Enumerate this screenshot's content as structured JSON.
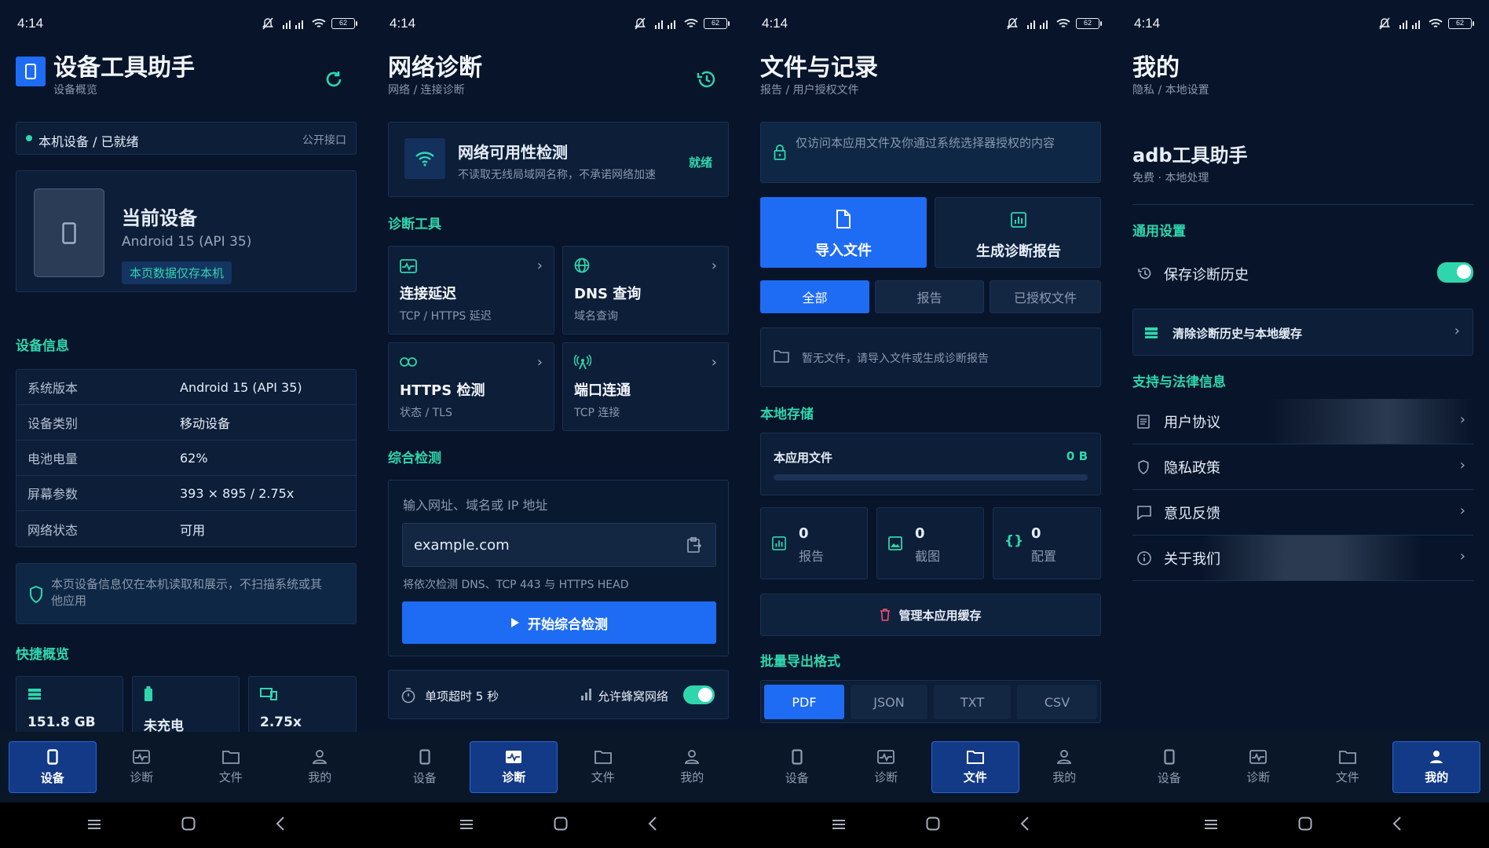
{
  "status_bar": {
    "time": "4:14",
    "battery": "62"
  },
  "nav": {
    "device": "设备",
    "diagnose": "诊断",
    "files": "文件",
    "mine": "我的"
  },
  "screen1": {
    "title": "设备工具助手",
    "subtitle": "设备概览",
    "status_label": "本机设备 / 已就绪",
    "status_right": "公开接口",
    "device_card": {
      "title": "当前设备",
      "os": "Android 15 (API 35)",
      "badge": "本页数据仅存本机"
    },
    "info_section": "设备信息",
    "info_rows": [
      {
        "key": "系统版本",
        "value": "Android 15 (API 35)"
      },
      {
        "key": "设备类别",
        "value": "移动设备"
      },
      {
        "key": "电池电量",
        "value": "62%"
      },
      {
        "key": "屏幕参数",
        "value": "393 × 895 / 2.75x"
      },
      {
        "key": "网络状态",
        "value": "可用"
      }
    ],
    "notice": "本页设备信息仅在本机读取和展示，不扫描系统或其他应用",
    "quick_section": "快捷概览",
    "quick": [
      {
        "value": "151.8 GB"
      },
      {
        "value": "未充电"
      },
      {
        "value": "2.75x"
      }
    ]
  },
  "screen2": {
    "title": "网络诊断",
    "subtitle": "网络 / 连接诊断",
    "avail_title": "网络可用性检测",
    "avail_sub": "不读取无线局域网名称，不承诺网络加速",
    "avail_status": "就绪",
    "tools_section": "诊断工具",
    "tools": [
      {
        "title": "连接延迟",
        "sub": "TCP / HTTPS 延迟"
      },
      {
        "title": "DNS 查询",
        "sub": "域名查询"
      },
      {
        "title": "HTTPS 检测",
        "sub": "状态 / TLS"
      },
      {
        "title": "端口连通",
        "sub": "TCP 连接"
      }
    ],
    "combo_section": "综合检测",
    "input_label": "输入网址、域名或 IP 地址",
    "input_value": "example.com",
    "hint": "将依次检测 DNS、TCP 443 与 HTTPS HEAD",
    "start_button": "开始综合检测",
    "timeout": "单项超时 5 秒",
    "cellular": "允许蜂窝网络"
  },
  "screen3": {
    "title": "文件与记录",
    "subtitle": "报告 / 用户授权文件",
    "notice": "仅访问本应用文件及你通过系统选择器授权的内容",
    "import_button": "导入文件",
    "report_button": "生成诊断报告",
    "filters": [
      "全部",
      "报告",
      "已授权文件"
    ],
    "empty": "暂无文件，请导入文件或生成诊断报告",
    "storage_section": "本地存储",
    "app_files_label": "本应用文件",
    "app_files_size": "0 B",
    "app_files_fraction": 0,
    "stats": [
      {
        "count": "0",
        "label": "报告"
      },
      {
        "count": "0",
        "label": "截图"
      },
      {
        "count": "0",
        "label": "配置"
      }
    ],
    "manage_cache": "管理本应用缓存",
    "export_section": "批量导出格式",
    "formats": [
      "PDF",
      "JSON",
      "TXT",
      "CSV"
    ]
  },
  "screen4": {
    "title": "我的",
    "subtitle": "隐私 / 本地设置",
    "app_name": "adb工具助手",
    "app_meta": "免费 · 本地处理",
    "general_section": "通用设置",
    "save_history": "保存诊断历史",
    "clear_history": "清除诊断历史与本地缓存",
    "legal_section": "支持与法律信息",
    "legal_items": [
      "用户协议",
      "隐私政策",
      "意见反馈",
      "关于我们"
    ]
  },
  "colors": {
    "accent": "#2fd6ad",
    "primary": "#1f6cf4",
    "background": "#07142a",
    "card": "#0c1e38"
  }
}
